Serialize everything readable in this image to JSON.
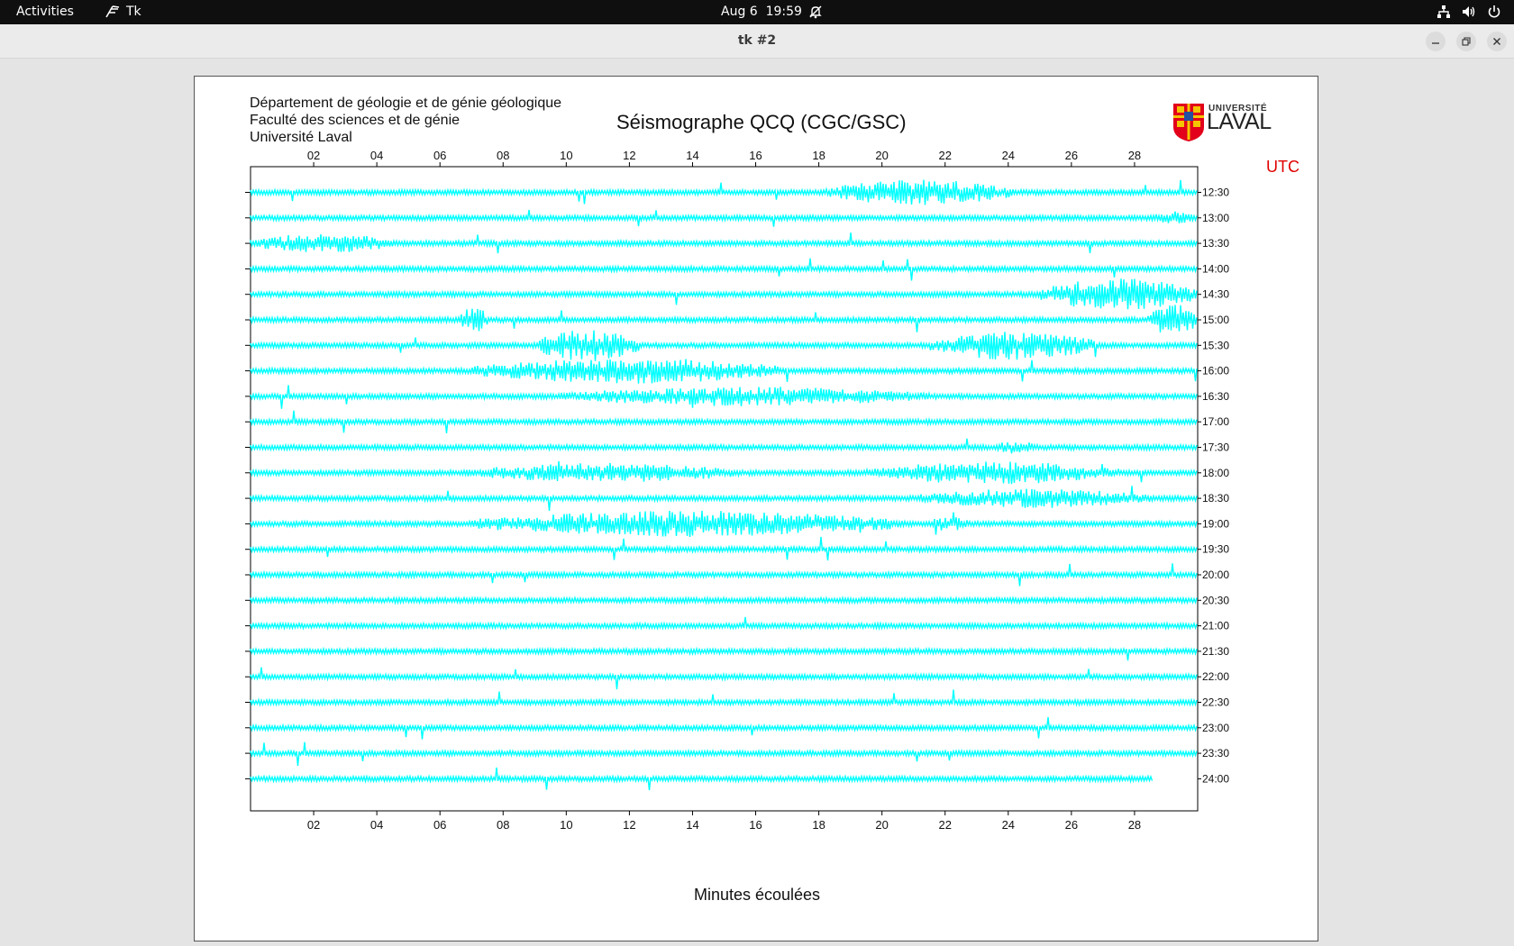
{
  "topbar": {
    "activities": "Activities",
    "app_name": "Tk",
    "date": "Aug 6",
    "time": "19:59"
  },
  "window": {
    "title": "tk #2"
  },
  "header": {
    "department": "Département de géologie et de génie géologique",
    "faculty": "Faculté des sciences et de génie",
    "university": "Université Laval",
    "title": "Séismographe QCQ (CGC/GSC)",
    "logo_small": "UNIVERSITÉ",
    "logo_big": "LAVAL"
  },
  "chart_data": {
    "type": "line",
    "title": "Séismographe QCQ (CGC/GSC)",
    "xlabel": "Minutes écoulées",
    "ylabel": "UTC",
    "xlim": [
      0,
      30
    ],
    "x_ticks": [
      "02",
      "04",
      "06",
      "08",
      "10",
      "12",
      "14",
      "16",
      "18",
      "20",
      "22",
      "24",
      "26",
      "28"
    ],
    "y_ticks": [
      "12:30",
      "13:00",
      "13:30",
      "14:00",
      "14:30",
      "15:00",
      "15:30",
      "16:00",
      "16:30",
      "17:00",
      "17:30",
      "18:00",
      "18:30",
      "19:00",
      "19:30",
      "20:00",
      "20:30",
      "21:00",
      "21:30",
      "22:00",
      "22:30",
      "23:00",
      "23:30",
      "24:00"
    ],
    "trace_color": "#00ffff",
    "last_trace_end_minute": 28.6,
    "activity_bursts": [
      {
        "trace": "12:30",
        "from": 18.2,
        "to": 24.2,
        "amp": 0.8
      },
      {
        "trace": "13:00",
        "from": 28.5,
        "to": 30,
        "amp": 0.4
      },
      {
        "trace": "13:30",
        "from": 0,
        "to": 4.6,
        "amp": 0.6
      },
      {
        "trace": "14:30",
        "from": 25,
        "to": 30,
        "amp": 1.0
      },
      {
        "trace": "15:00",
        "from": 6.6,
        "to": 7.5,
        "amp": 0.8
      },
      {
        "trace": "15:00",
        "from": 28.4,
        "to": 30,
        "amp": 1.0
      },
      {
        "trace": "15:30",
        "from": 9,
        "to": 12.3,
        "amp": 1.0
      },
      {
        "trace": "15:30",
        "from": 21.5,
        "to": 26.8,
        "amp": 0.9
      },
      {
        "trace": "16:00",
        "from": 7,
        "to": 17,
        "amp": 0.8
      },
      {
        "trace": "16:30",
        "from": 9.7,
        "to": 21.5,
        "amp": 0.6
      },
      {
        "trace": "17:30",
        "from": 23.5,
        "to": 25,
        "amp": 0.4
      },
      {
        "trace": "18:00",
        "from": 6.8,
        "to": 15.5,
        "amp": 0.6
      },
      {
        "trace": "18:00",
        "from": 19.5,
        "to": 27.5,
        "amp": 0.7
      },
      {
        "trace": "18:30",
        "from": 21,
        "to": 28.5,
        "amp": 0.6
      },
      {
        "trace": "19:00",
        "from": 6.9,
        "to": 20.7,
        "amp": 0.8
      },
      {
        "trace": "19:00",
        "from": 21.5,
        "to": 22.8,
        "amp": 0.5
      }
    ]
  }
}
